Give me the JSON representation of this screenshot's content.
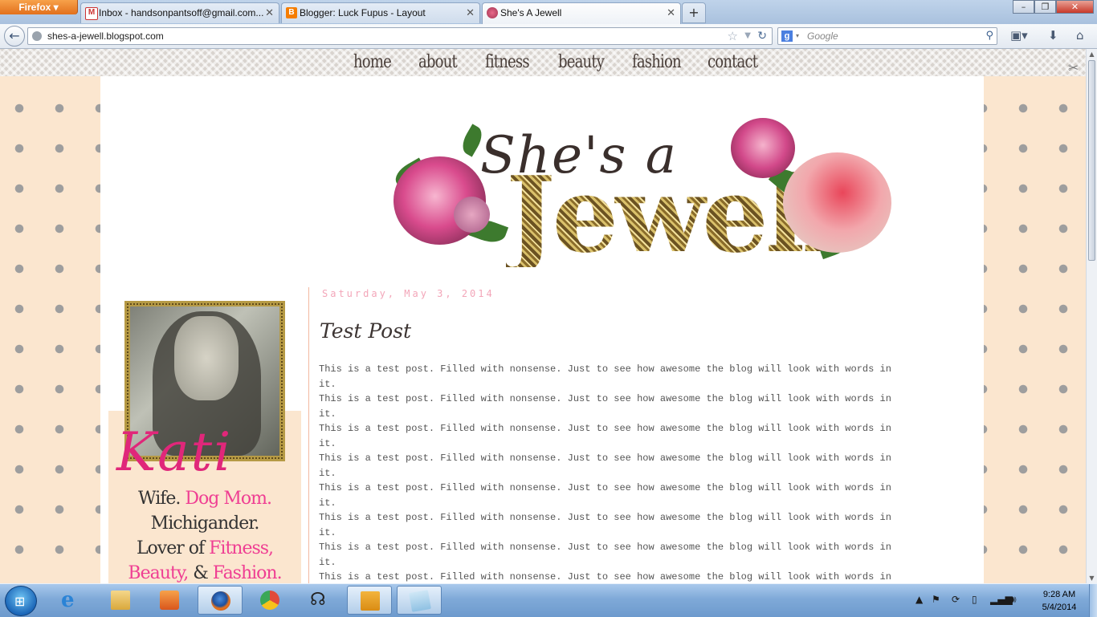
{
  "browser": {
    "menu_button": "Firefox",
    "tabs": [
      {
        "label": "Inbox - handsonpantsoff@gmail.com...",
        "icon": "gmail-icon"
      },
      {
        "label": "Blogger: Luck Fupus - Layout",
        "icon": "blogger-icon"
      },
      {
        "label": "She's A Jewell",
        "icon": "rose-favicon"
      }
    ],
    "new_tab": "+",
    "url": "shes-a-jewell.blogspot.com",
    "search_placeholder": "Google",
    "window_controls": [
      "–",
      "❐",
      "✕"
    ]
  },
  "blog": {
    "nav": [
      "home",
      "about",
      "fitness",
      "beauty",
      "fashion",
      "contact"
    ],
    "header": {
      "line1": "She's a",
      "line2": "Jewell"
    },
    "profile": {
      "name": "Kati",
      "line1_plain": "Wife. ",
      "line1_pink": "Dog Mom.",
      "line2": "Michigander.",
      "line3_plain": "Lover of ",
      "line3_pink": "Fitness,",
      "line4_pink1": "Beauty,",
      "line4_plain": " & ",
      "line4_pink2": "Fashion."
    },
    "post": {
      "date": "Saturday, May 3, 2014",
      "title": "Test Post",
      "lines": [
        "This is a test post. Filled with nonsense. Just to see how awesome the blog will look with words in",
        "it.",
        "This is a test post. Filled with nonsense. Just to see how awesome the blog will look with words in",
        "it.",
        "This is a test post. Filled with nonsense. Just to see how awesome the blog will look with words in",
        "it.",
        "This is a test post. Filled with nonsense. Just to see how awesome the blog will look with words in",
        "it.",
        "This is a test post. Filled with nonsense. Just to see how awesome the blog will look with words in",
        "it.",
        "This is a test post. Filled with nonsense. Just to see how awesome the blog will look with words in",
        "it.",
        "This is a test post. Filled with nonsense. Just to see how awesome the blog will look with words in",
        "it.",
        "This is a test post. Filled with nonsense. Just to see how awesome the blog will look with words in"
      ]
    }
  },
  "taskbar": {
    "apps": [
      "internet-explorer",
      "windows-explorer",
      "media-player",
      "firefox",
      "chrome",
      "headphones-app",
      "slideshow-app",
      "notepad"
    ],
    "time": "9:28 AM",
    "date": "5/4/2014"
  },
  "colors": {
    "pink_accent": "#ef3e93",
    "peach_bg": "#fbe6cf",
    "dot": "#9e9e9e",
    "gold": "#b69a45"
  }
}
